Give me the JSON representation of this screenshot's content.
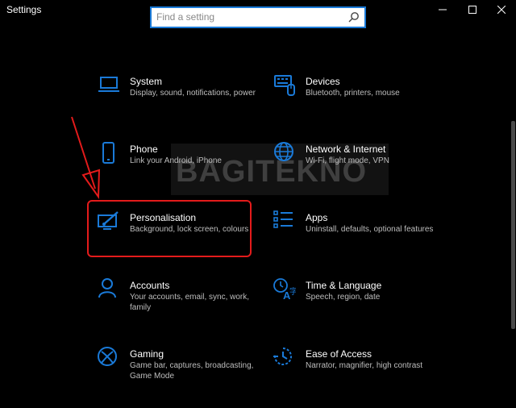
{
  "window": {
    "title": "Settings"
  },
  "search": {
    "placeholder": "Find a setting"
  },
  "watermark": "BAGITEKNO",
  "accent_color": "#1a7ad8",
  "highlight_color": "#e41b1b",
  "categories": [
    {
      "title": "System",
      "description": "Display, sound, notifications, power",
      "icon": "laptop-icon"
    },
    {
      "title": "Devices",
      "description": "Bluetooth, printers, mouse",
      "icon": "keyboard-icon"
    },
    {
      "title": "Phone",
      "description": "Link your Android, iPhone",
      "icon": "phone-icon"
    },
    {
      "title": "Network & Internet",
      "description": "Wi-Fi, flight mode, VPN",
      "icon": "globe-icon"
    },
    {
      "title": "Personalisation",
      "description": "Background, lock screen, colours",
      "icon": "paint-brush-icon"
    },
    {
      "title": "Apps",
      "description": "Uninstall, defaults, optional features",
      "icon": "apps-list-icon"
    },
    {
      "title": "Accounts",
      "description": "Your accounts, email, sync, work, family",
      "icon": "person-icon"
    },
    {
      "title": "Time & Language",
      "description": "Speech, region, date",
      "icon": "time-language-icon"
    },
    {
      "title": "Gaming",
      "description": "Game bar, captures, broadcasting, Game Mode",
      "icon": "xbox-icon"
    },
    {
      "title": "Ease of Access",
      "description": "Narrator, magnifier, high contrast",
      "icon": "ease-of-access-icon"
    }
  ]
}
